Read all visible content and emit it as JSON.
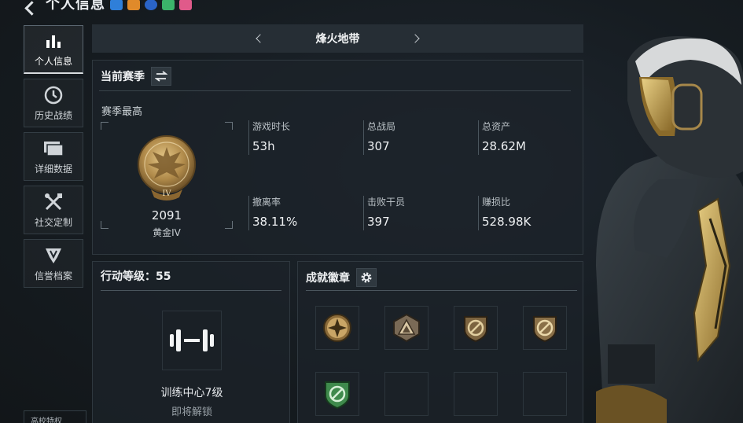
{
  "header": {
    "title": "个人信息"
  },
  "sidebar": {
    "items": [
      {
        "label": "个人信息",
        "icon": "bar-chart-icon",
        "active": true
      },
      {
        "label": "历史战绩",
        "icon": "history-clock-icon",
        "active": false
      },
      {
        "label": "详细数据",
        "icon": "folder-stack-icon",
        "active": false
      },
      {
        "label": "社交定制",
        "icon": "tools-icon",
        "active": false
      },
      {
        "label": "信誉档案",
        "icon": "shield-emblem-icon",
        "active": false
      }
    ],
    "bottom_label": "高校特权"
  },
  "season": {
    "title": "烽火地带"
  },
  "stats_panel": {
    "title": "当前赛季",
    "best_label": "赛季最高",
    "rank": {
      "score": "2091",
      "name": "黄金IV",
      "numeral": "IV"
    },
    "stats": [
      {
        "label": "游戏时长",
        "value": "53h"
      },
      {
        "label": "总战局",
        "value": "307"
      },
      {
        "label": "总资产",
        "value": "28.62M"
      },
      {
        "label": "撤离率",
        "value": "38.11%"
      },
      {
        "label": "击败干员",
        "value": "397"
      },
      {
        "label": "赚损比",
        "value": "528.98K"
      }
    ]
  },
  "action_panel": {
    "title": "行动等级：55",
    "training_label": "训练中心7级",
    "status_label": "即将解锁"
  },
  "achievements": {
    "title": "成就徽章",
    "slots": [
      {
        "icon": "compass-star-badge-icon",
        "filled": true
      },
      {
        "icon": "triangle-badge-icon",
        "filled": true
      },
      {
        "icon": "shield-slash-badge-icon",
        "filled": true
      },
      {
        "icon": "shield-slash-badge-icon",
        "filled": true
      },
      {
        "icon": "green-shield-badge-icon",
        "filled": true
      },
      {
        "icon": "empty-slot",
        "filled": false
      },
      {
        "icon": "empty-slot",
        "filled": false
      },
      {
        "icon": "empty-slot",
        "filled": false
      }
    ]
  },
  "colors": {
    "gold": "#b8924a",
    "panel": "#1c2329",
    "accent_green": "#3f8a4c"
  }
}
